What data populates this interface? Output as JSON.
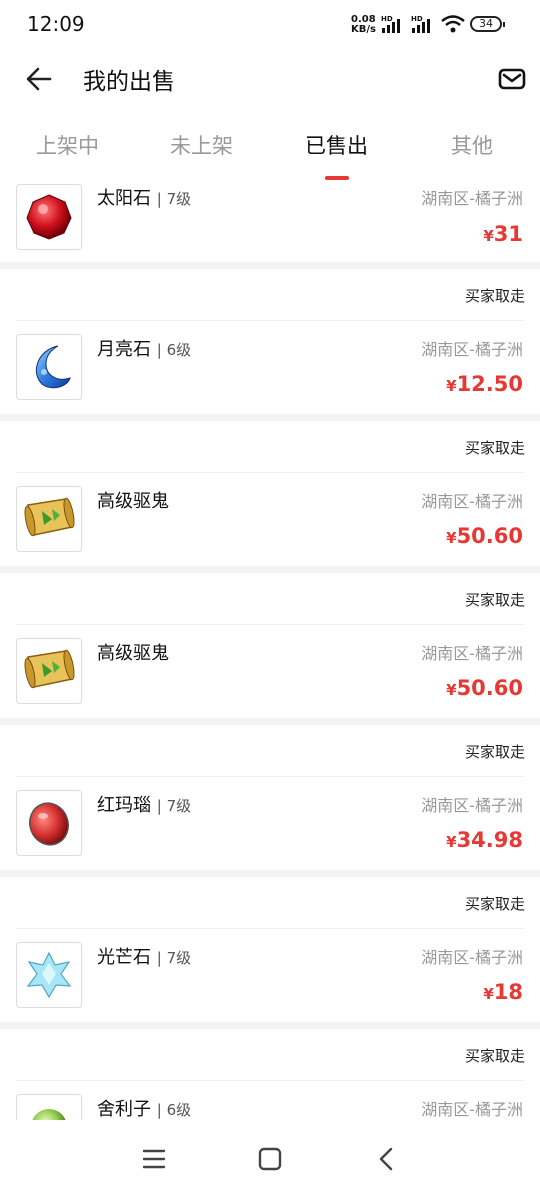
{
  "status_bar": {
    "time": "12:09",
    "net_speed_value": "0.08",
    "net_speed_unit": "KB/s",
    "battery": "34",
    "hd1": "HD",
    "hd2": "HD"
  },
  "header": {
    "title": "我的出售"
  },
  "tabs": [
    {
      "label": "上架中",
      "active": false
    },
    {
      "label": "未上架",
      "active": false
    },
    {
      "label": "已售出",
      "active": true
    },
    {
      "label": "其他",
      "active": false
    }
  ],
  "items": [
    {
      "name": "太阳石",
      "level": "7级",
      "region": "湖南区-橘子洲",
      "price": "31",
      "currency": "¥",
      "status": "",
      "icon": "red-gem-icon"
    },
    {
      "name": "月亮石",
      "level": "6级",
      "region": "湖南区-橘子洲",
      "price": "12.50",
      "currency": "¥",
      "status": "买家取走",
      "icon": "blue-moon-stone-icon"
    },
    {
      "name": "高级驱鬼",
      "level": "",
      "region": "湖南区-橘子洲",
      "price": "50.60",
      "currency": "¥",
      "status": "买家取走",
      "icon": "scroll-icon"
    },
    {
      "name": "高级驱鬼",
      "level": "",
      "region": "湖南区-橘子洲",
      "price": "50.60",
      "currency": "¥",
      "status": "买家取走",
      "icon": "scroll-icon"
    },
    {
      "name": "红玛瑙",
      "level": "7级",
      "region": "湖南区-橘子洲",
      "price": "34.98",
      "currency": "¥",
      "status": "买家取走",
      "icon": "red-agate-icon"
    },
    {
      "name": "光芒石",
      "level": "7级",
      "region": "湖南区-橘子洲",
      "price": "18",
      "currency": "¥",
      "status": "买家取走",
      "icon": "crystal-icon"
    },
    {
      "name": "舍利子",
      "level": "6级",
      "region": "湖南区-橘子洲",
      "price": "",
      "currency": "",
      "status": "买家取走",
      "icon": "green-pearl-icon"
    }
  ],
  "colors": {
    "accent": "#e53935",
    "separator": "#f3f3f3"
  }
}
